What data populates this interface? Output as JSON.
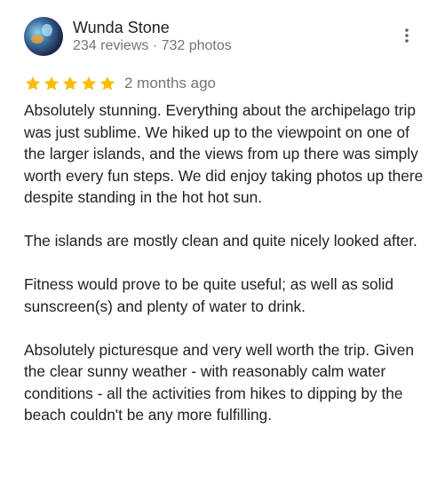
{
  "author": {
    "name": "Wunda Stone",
    "meta": "234 reviews · 732 photos"
  },
  "rating": {
    "stars": 5,
    "max": 5,
    "star_color": "#fbbc04",
    "date": "2 months ago"
  },
  "review": {
    "paragraphs": [
      "Absolutely stunning. Everything about the archipelago trip was just sublime. We hiked up to the viewpoint on one of the larger islands, and the views from up there was simply worth every fun steps. We did enjoy taking photos up there despite standing in the hot hot sun.",
      "The islands are mostly clean and quite nicely looked after.",
      "Fitness would prove to be quite useful; as well as solid sunscreen(s) and plenty of water to drink.",
      "Absolutely picturesque and very well worth the trip. Given the clear sunny weather - with reasonably calm water conditions - all the activities from hikes to dipping by the beach couldn't be any more fulfilling."
    ]
  },
  "icons": {
    "more": "more-vert-icon",
    "star": "star-icon"
  }
}
